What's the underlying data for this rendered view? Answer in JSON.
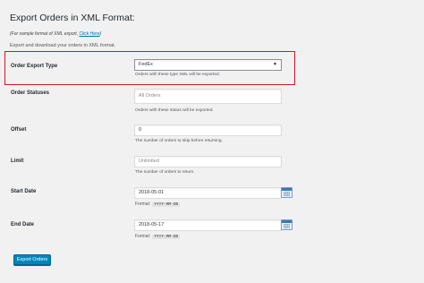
{
  "page": {
    "title": "Export Orders in XML Format:",
    "sample_note_prefix": "(For sample format of XML export, ",
    "sample_note_link": "Click Here",
    "sample_note_suffix": ")",
    "description": "Export and download your orders in XML format."
  },
  "form": {
    "order_export_type": {
      "label": "Order Export Type",
      "selected": "FedEx",
      "help": "Orders with these type XML will be exported."
    },
    "order_statuses": {
      "label": "Order Statuses",
      "placeholder": "All Orders",
      "help": "Orders with these status will be exported."
    },
    "offset": {
      "label": "Offset",
      "value": "0",
      "help": "The number of orders to skip before returning."
    },
    "limit": {
      "label": "Limit",
      "placeholder": "Unlimited",
      "help": "The number of orders to return."
    },
    "start_date": {
      "label": "Start Date",
      "value": "2018-05-01",
      "format_label": "Format:",
      "format_value": "YYYY-MM-DD"
    },
    "end_date": {
      "label": "End Date",
      "value": "2018-05-17",
      "format_label": "Format:",
      "format_value": "YYYY-MM-DD"
    }
  },
  "actions": {
    "export_label": "Export Orders"
  },
  "colors": {
    "highlight_border": "#d0162b",
    "primary_button": "#0085ba",
    "link": "#0073aa"
  }
}
